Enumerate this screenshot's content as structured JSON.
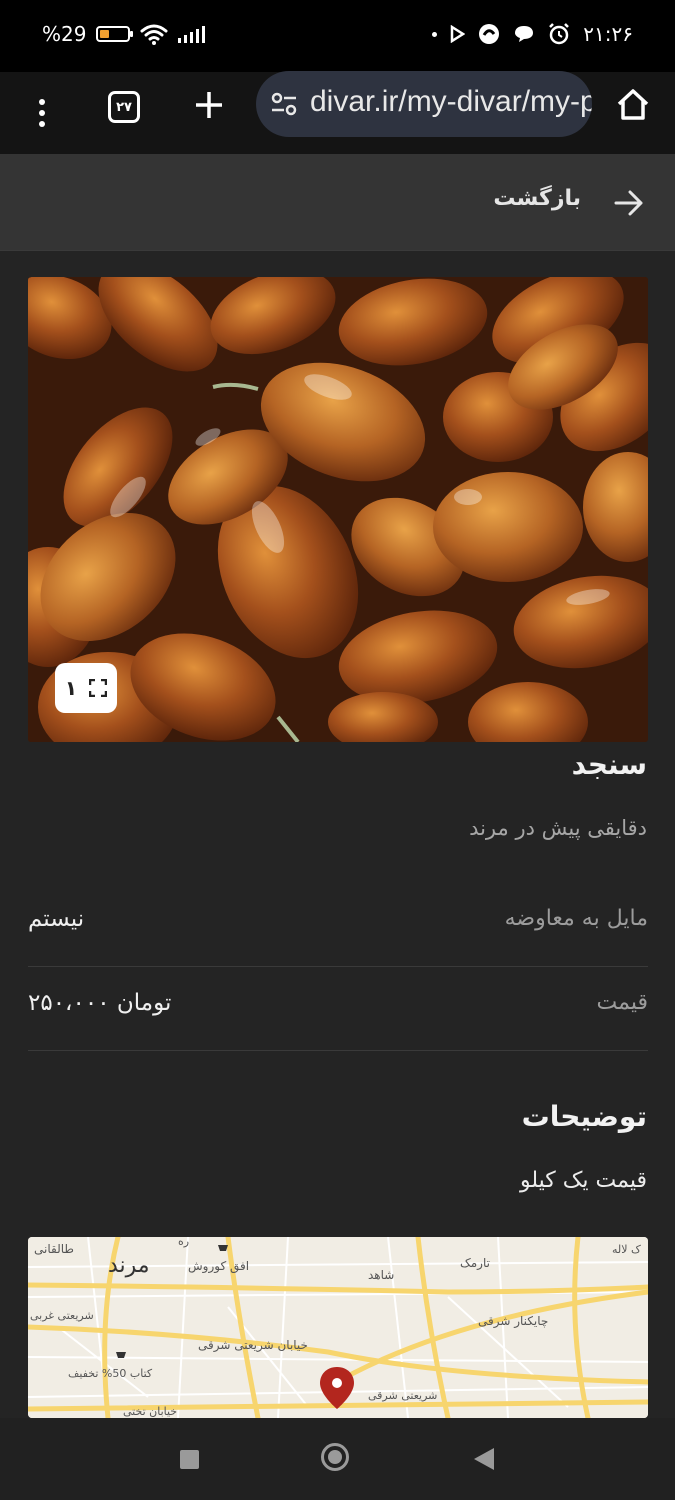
{
  "status": {
    "battery_text": "%29",
    "time": "۲۱:۲۶"
  },
  "browser": {
    "tabs_count": "۲۷",
    "url": "divar.ir/my-divar/my-posts"
  },
  "header": {
    "back_label": "بازگشت"
  },
  "gallery": {
    "counter": "۱"
  },
  "post": {
    "title": "سنجد",
    "subtitle": "دقایقی پیش در مرند",
    "fields": [
      {
        "key": "مایل به معاوضه",
        "value": "نیستم"
      },
      {
        "key": "قیمت",
        "value": "۲۵۰،۰۰۰ تومان"
      }
    ],
    "description_heading": "توضیحات",
    "description": "قیمت یک کیلو"
  },
  "map": {
    "labels": [
      "مرند",
      "طالقانی",
      "افق کوروش",
      "شاهد",
      "تارمک",
      "چایکنار شرقی",
      "شریعتی غربی",
      "خیابان شریعتی شرقی",
      "کتاب 50% تخفیف",
      "خیابان تختی",
      "شریعتی شرقی",
      "ک لاله",
      "ره"
    ]
  },
  "colors": {
    "pin": "#b3261e",
    "road": "#f7d56e"
  }
}
